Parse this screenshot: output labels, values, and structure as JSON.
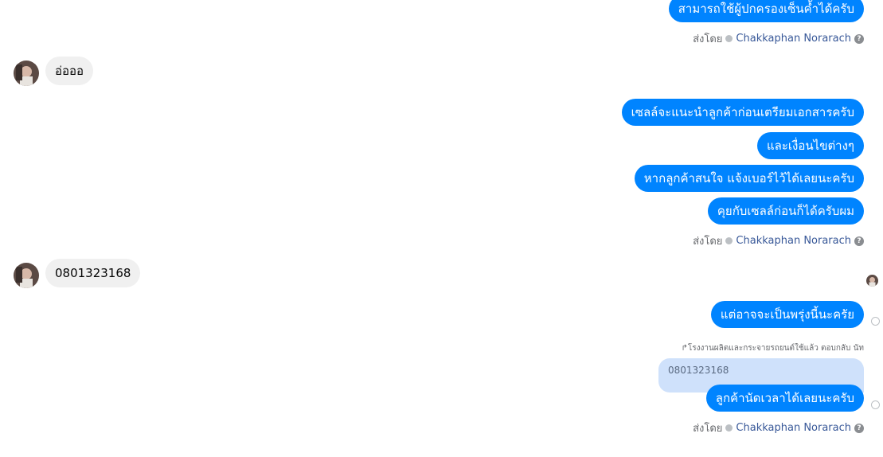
{
  "thread": {
    "outgoing": {
      "msg_guardian": "สามารถใช้ผู้ปกครองเซ็นค้ำได้ครับ",
      "msg_sales_intro": "เซลล์จะแนะนำลูกค้าก่อนเตรียมเอกสารครับ",
      "msg_conditions": "และเงื่อนไขต่างๆ",
      "msg_leave_number": "หากลูกค้าสนใจ แจ้งเบอร์ไว้ได้เลยนะครับ",
      "msg_talk_sales": "คุยกับเซลล์ก่อนก็ได้ครับผม",
      "msg_maybe_tomorrow": "แต่อาจจะเป็นพรุ่งนี้นะครัย",
      "msg_schedule": "ลูกค้านัดเวลาได้เลยนะครับ"
    },
    "incoming": {
      "msg_ok": "อ่อออ",
      "msg_phone": "0801323168"
    },
    "sent_by": {
      "prefix": "ส่งโดย",
      "name": "Chakkaphan Norarach"
    },
    "reply": {
      "label": "โรงงานผลิตและกระจายรถยนต์ใช้แล้ว ตอบกลับ นัท",
      "quoted_text": "0801323168"
    }
  },
  "colors": {
    "outgoing_bubble": "#0084ff",
    "incoming_bubble": "#f0f0f0",
    "quote_bubble": "#cfe1fb",
    "sender_name": "#385898"
  },
  "icons": {
    "avatar": "avatar-photo",
    "verified": "dot-icon",
    "help": "question-circle-icon",
    "delivered": "check-circle-icon"
  }
}
